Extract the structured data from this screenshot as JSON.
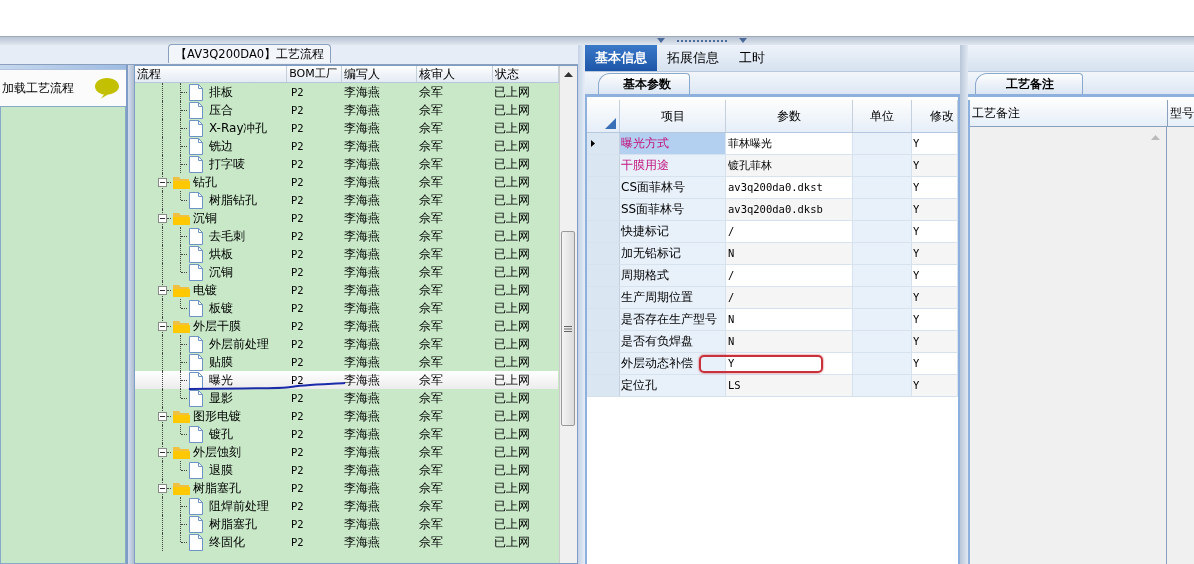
{
  "left_panel": {
    "title": "加载工艺流程"
  },
  "flow_tab": {
    "label": "【AV3Q200DA0】工艺流程"
  },
  "tree": {
    "columns": [
      "流程",
      "BOM工厂",
      "编写人",
      "核审人",
      "状态"
    ],
    "rows": [
      {
        "kind": "leaf",
        "name": "排板",
        "bom": "P2",
        "writer": "李海燕",
        "reviewer": "佘军",
        "status": "已上网",
        "selected": false,
        "underlined": false
      },
      {
        "kind": "leaf",
        "name": "压合",
        "bom": "P2",
        "writer": "李海燕",
        "reviewer": "佘军",
        "status": "已上网",
        "selected": false,
        "underlined": false
      },
      {
        "kind": "leaf",
        "name": "X-Ray冲孔",
        "bom": "P2",
        "writer": "李海燕",
        "reviewer": "佘军",
        "status": "已上网",
        "selected": false,
        "underlined": false
      },
      {
        "kind": "leaf",
        "name": "铣边",
        "bom": "P2",
        "writer": "李海燕",
        "reviewer": "佘军",
        "status": "已上网",
        "selected": false,
        "underlined": false
      },
      {
        "kind": "leaf",
        "name": "打字唛",
        "bom": "P2",
        "writer": "李海燕",
        "reviewer": "佘军",
        "status": "已上网",
        "selected": false,
        "underlined": false
      },
      {
        "kind": "folder",
        "name": "钻孔",
        "bom": "P2",
        "writer": "李海燕",
        "reviewer": "佘军",
        "status": "已上网",
        "selected": false,
        "underlined": false,
        "expanded": true,
        "children": [
          {
            "kind": "leaf",
            "name": "树脂钻孔",
            "bom": "P2",
            "writer": "李海燕",
            "reviewer": "佘军",
            "status": "已上网",
            "selected": false,
            "underlined": false
          }
        ]
      },
      {
        "kind": "folder",
        "name": "沉铜",
        "bom": "P2",
        "writer": "李海燕",
        "reviewer": "佘军",
        "status": "已上网",
        "selected": false,
        "underlined": false,
        "expanded": true,
        "children": [
          {
            "kind": "leaf",
            "name": "去毛刺",
            "bom": "P2",
            "writer": "李海燕",
            "reviewer": "佘军",
            "status": "已上网",
            "selected": false,
            "underlined": false
          },
          {
            "kind": "leaf",
            "name": "烘板",
            "bom": "P2",
            "writer": "李海燕",
            "reviewer": "佘军",
            "status": "已上网",
            "selected": false,
            "underlined": false
          },
          {
            "kind": "leaf",
            "name": "沉铜",
            "bom": "P2",
            "writer": "李海燕",
            "reviewer": "佘军",
            "status": "已上网",
            "selected": false,
            "underlined": false
          }
        ]
      },
      {
        "kind": "folder",
        "name": "电镀",
        "bom": "P2",
        "writer": "李海燕",
        "reviewer": "佘军",
        "status": "已上网",
        "selected": false,
        "underlined": false,
        "expanded": true,
        "children": [
          {
            "kind": "leaf",
            "name": "板镀",
            "bom": "P2",
            "writer": "李海燕",
            "reviewer": "佘军",
            "status": "已上网",
            "selected": false,
            "underlined": false
          }
        ]
      },
      {
        "kind": "folder",
        "name": "外层干膜",
        "bom": "P2",
        "writer": "李海燕",
        "reviewer": "佘军",
        "status": "已上网",
        "selected": false,
        "underlined": false,
        "expanded": true,
        "children": [
          {
            "kind": "leaf",
            "name": "外层前处理",
            "bom": "P2",
            "writer": "李海燕",
            "reviewer": "佘军",
            "status": "已上网",
            "selected": false,
            "underlined": false
          },
          {
            "kind": "leaf",
            "name": "贴膜",
            "bom": "P2",
            "writer": "李海燕",
            "reviewer": "佘军",
            "status": "已上网",
            "selected": false,
            "underlined": false
          },
          {
            "kind": "leaf",
            "name": "曝光",
            "bom": "P2",
            "writer": "李海燕",
            "reviewer": "佘军",
            "status": "已上网",
            "selected": true,
            "underlined": true
          },
          {
            "kind": "leaf",
            "name": "显影",
            "bom": "P2",
            "writer": "李海燕",
            "reviewer": "佘军",
            "status": "已上网",
            "selected": false,
            "underlined": false
          }
        ]
      },
      {
        "kind": "folder",
        "name": "图形电镀",
        "bom": "P2",
        "writer": "李海燕",
        "reviewer": "佘军",
        "status": "已上网",
        "selected": false,
        "underlined": false,
        "expanded": true,
        "children": [
          {
            "kind": "leaf",
            "name": "镀孔",
            "bom": "P2",
            "writer": "李海燕",
            "reviewer": "佘军",
            "status": "已上网",
            "selected": false,
            "underlined": false
          }
        ]
      },
      {
        "kind": "folder",
        "name": "外层蚀刻",
        "bom": "P2",
        "writer": "李海燕",
        "reviewer": "佘军",
        "status": "已上网",
        "selected": false,
        "underlined": false,
        "expanded": true,
        "children": [
          {
            "kind": "leaf",
            "name": "退膜",
            "bom": "P2",
            "writer": "李海燕",
            "reviewer": "佘军",
            "status": "已上网",
            "selected": false,
            "underlined": false
          }
        ]
      },
      {
        "kind": "folder",
        "name": "树脂塞孔",
        "bom": "P2",
        "writer": "李海燕",
        "reviewer": "佘军",
        "status": "已上网",
        "selected": false,
        "underlined": false,
        "expanded": true,
        "children": [
          {
            "kind": "leaf",
            "name": "阻焊前处理",
            "bom": "P2",
            "writer": "李海燕",
            "reviewer": "佘军",
            "status": "已上网",
            "selected": false,
            "underlined": false
          },
          {
            "kind": "leaf",
            "name": "树脂塞孔",
            "bom": "P2",
            "writer": "李海燕",
            "reviewer": "佘军",
            "status": "已上网",
            "selected": false,
            "underlined": false
          },
          {
            "kind": "leaf",
            "name": "终固化",
            "bom": "P2",
            "writer": "李海燕",
            "reviewer": "佘军",
            "status": "已上网",
            "selected": false,
            "underlined": false
          }
        ]
      }
    ]
  },
  "info_tabs": [
    {
      "label": "基本信息",
      "selected": true
    },
    {
      "label": "拓展信息",
      "selected": false
    },
    {
      "label": "工时",
      "selected": false
    }
  ],
  "params": {
    "tab": "基本参数",
    "columns": [
      "项目",
      "参数",
      "单位",
      "修改"
    ],
    "rows": [
      {
        "item": "曝光方式",
        "value": "菲林曝光",
        "modify": "Y",
        "highlighted": true,
        "selected": true,
        "circled": false
      },
      {
        "item": "干膜用途",
        "value": "镀孔菲林",
        "modify": "Y",
        "highlighted": true,
        "selected": false,
        "circled": false
      },
      {
        "item": "CS面菲林号",
        "value": "av3q200da0.dkst",
        "modify": "Y",
        "highlighted": false,
        "selected": false,
        "circled": false
      },
      {
        "item": "SS面菲林号",
        "value": "av3q200da0.dksb",
        "modify": "Y",
        "highlighted": false,
        "selected": false,
        "circled": false
      },
      {
        "item": "快捷标记",
        "value": "/",
        "modify": "Y",
        "highlighted": false,
        "selected": false,
        "circled": false
      },
      {
        "item": "加无铅标记",
        "value": "N",
        "modify": "Y",
        "highlighted": false,
        "selected": false,
        "circled": false
      },
      {
        "item": "周期格式",
        "value": "/",
        "modify": "Y",
        "highlighted": false,
        "selected": false,
        "circled": false
      },
      {
        "item": "生产周期位置",
        "value": "/",
        "modify": "Y",
        "highlighted": false,
        "selected": false,
        "circled": false
      },
      {
        "item": "是否存在生产型号",
        "value": "N",
        "modify": "Y",
        "highlighted": false,
        "selected": false,
        "circled": false
      },
      {
        "item": "是否有负焊盘",
        "value": "N",
        "modify": "Y",
        "highlighted": false,
        "selected": false,
        "circled": false
      },
      {
        "item": "外层动态补偿",
        "value": "Y",
        "modify": "Y",
        "highlighted": false,
        "selected": false,
        "circled": true
      },
      {
        "item": "定位孔",
        "value": "LS",
        "modify": "Y",
        "highlighted": false,
        "selected": false,
        "circled": false
      }
    ]
  },
  "notes": {
    "tab": "工艺备注",
    "columns": [
      "工艺备注",
      "型号"
    ]
  }
}
